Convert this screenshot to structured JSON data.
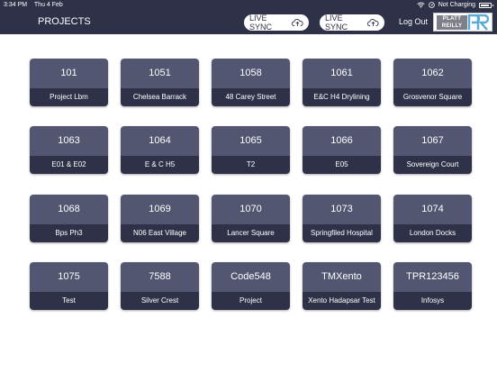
{
  "status": {
    "time": "3:34 PM",
    "date": "Thu 4 Feb",
    "battery_text": "Not Charging",
    "battery_level": 0.9
  },
  "header": {
    "title": "PROJECTS",
    "sync_buttons": [
      {
        "label": "LIVE SYNC",
        "icon": "cloud-upload-icon"
      },
      {
        "label": "LIVE SYNC",
        "icon": "cloud-upload-icon"
      }
    ],
    "logout": "Log Out",
    "logo": {
      "line1": "PLATT",
      "line2": "REILLY"
    }
  },
  "colors": {
    "navbar": "#2f3148",
    "card_top": "#525671",
    "card_bottom": "#2f3148"
  },
  "projects": [
    {
      "number": "101",
      "name": "Project Lbm"
    },
    {
      "number": "1051",
      "name": "Chelsea Barrack"
    },
    {
      "number": "1058",
      "name": "48 Carey Street"
    },
    {
      "number": "1061",
      "name": "E&C H4 Drylining"
    },
    {
      "number": "1062",
      "name": "Grosvenor Square"
    },
    {
      "number": "1063",
      "name": "E01 & E02"
    },
    {
      "number": "1064",
      "name": "E & C H5"
    },
    {
      "number": "1065",
      "name": "T2"
    },
    {
      "number": "1066",
      "name": "E05"
    },
    {
      "number": "1067",
      "name": "Sovereign Court"
    },
    {
      "number": "1068",
      "name": "Bps Ph3"
    },
    {
      "number": "1069",
      "name": "N06 East Village"
    },
    {
      "number": "1070",
      "name": "Lancer Square"
    },
    {
      "number": "1073",
      "name": "Springfiled Hospital"
    },
    {
      "number": "1074",
      "name": "London Docks"
    },
    {
      "number": "1075",
      "name": "Test"
    },
    {
      "number": "7588",
      "name": "Silver Crest"
    },
    {
      "number": "Code548",
      "name": "Project"
    },
    {
      "number": "TMXento",
      "name": "Xento Hadapsar Test"
    },
    {
      "number": "TPR123456",
      "name": "Infosys"
    }
  ]
}
